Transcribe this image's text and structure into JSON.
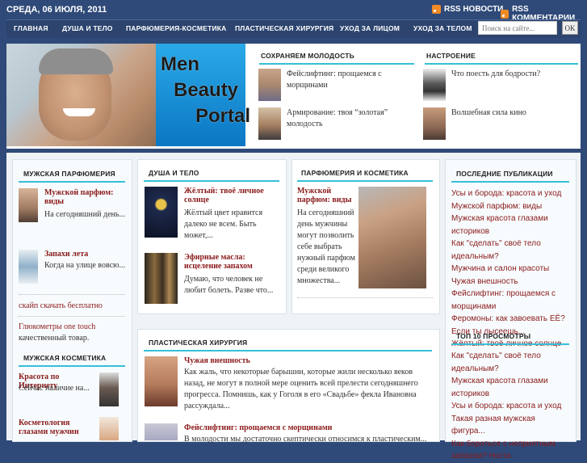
{
  "topbar": {
    "date": "СРЕДА, 06 ИЮЛЯ, 2011",
    "rss_news": "RSS НОВОСТИ",
    "rss_comments": "RSS КОММЕНТАРИИ"
  },
  "nav": {
    "items": [
      "ГЛАВНАЯ",
      "ДУША И ТЕЛО",
      "ПАРФЮМЕРИЯ-КОСМЕТИКА",
      "ПЛАСТИЧЕСКАЯ ХИРУРГИЯ",
      "УХОД ЗА ЛИЦОМ",
      "УХОД ЗА ТЕЛОМ"
    ],
    "search_placeholder": "Поиск на сайте...",
    "search_button": "OK"
  },
  "banner": {
    "line1": "Men",
    "line2": "Beauty",
    "line3": "Portal"
  },
  "header_sections": {
    "left": {
      "title": "СОХРАНЯЕМ МОЛОДОСТЬ",
      "items": [
        "Фейслифтинг: прощаемся с морщинами",
        "Армирование: твоя “золотая” молодость"
      ]
    },
    "right": {
      "title": "НАСТРОЕНИЕ",
      "items": [
        "Что поесть для бодрости?",
        "Волшебная сила кино"
      ]
    }
  },
  "left_col": {
    "title1": "МУЖСКАЯ ПАРФЮМЕРИЯ",
    "post1_title": "Мужской парфюм: виды",
    "post1_text": "На сегодняшний день...",
    "post2_title": "Запахи лета",
    "post2_text": "Когда на улице вовсю...",
    "link1": "скайп скачать бесплатно",
    "link2": "Глюкометры one touch",
    "link2_tail": "качественный товар.",
    "title2": "МУЖСКАЯ КОСМЕТИКА",
    "post3_title": "Красота по Интернету",
    "post3_text": "Сейчас наличие на...",
    "post4_title": "Косметология глазами мужчин"
  },
  "dusha": {
    "title": "ДУША И ТЕЛО",
    "post1_title": "Жёлтый: твоё личное солнце",
    "post1_text": "Жёлтый цвет нравится далеко не всем. Быть может,...",
    "post2_title": "Эфирные масла: исцеление запахом",
    "post2_text": "Думаю, что человек не любит болеть. Разве что..."
  },
  "parfum": {
    "title": "ПАРФЮМЕРИЯ И КОСМЕТИКА",
    "post_title": "Мужской парфюм: виды",
    "post_text": "На сегодняшний день мужчины могут позволить себе выбрать нужный парфюм среди великого множества..."
  },
  "plastic": {
    "title": "ПЛАСТИЧЕСКАЯ ХИРУРГИЯ",
    "post1_title": "Чужая внешность",
    "post1_text": "Как жаль, что некоторые барышни, которые жили несколько веков назад, не могут в полной мере оценить всей прелести сегодняшнего прогресса. Помнишь, как у Гоголя в его «Свадьбе» фекла Ивановна рассуждала...",
    "post2_title": "Фейслифтинг: прощаемся с морщинами",
    "post2_text": "В молодости мы достаточно скептически относимся к пластическим..."
  },
  "right_col": {
    "title1": "ПОСЛЕДНИЕ ПУБЛИКАЦИИ",
    "recent": [
      "Усы и борода: красота и уход",
      "Мужской парфюм: виды",
      "Мужская красота глазами историков",
      "Как \"сделать\" своё тело идеальным?",
      "Мужчина и салон красоты",
      "Чужая внешность",
      "Фейслифтинг: прощаемся с морщинами",
      "Феромоны: как завоевать ЕЁ? Если ты лысеешь...",
      "Жёлтый: твоё личное солнце"
    ],
    "title2": "ТОП 10 ПРОСМОТРЫ",
    "top": [
      "Как \"сделать\" своё тело идеальным?",
      "Мужская красота глазами историков",
      "Усы и борода: красота и уход",
      "Такая разная мужская фигура...",
      "Как бороться с неприятным запахом? Ногти."
    ]
  },
  "colors": {
    "bg": "#2f4a78",
    "accent_line": "#35c0d8",
    "link": "#8b1a1a",
    "banner_blue": "#1a92d8"
  }
}
